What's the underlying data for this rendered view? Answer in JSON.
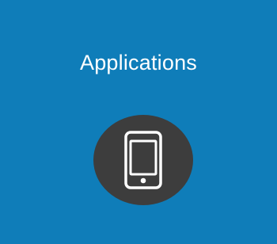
{
  "tile": {
    "title": "Applications",
    "icon": "tablet-icon",
    "background_color": "#0f7db9",
    "icon_circle_color": "#3d3d3d",
    "icon_color": "#ffffff"
  }
}
